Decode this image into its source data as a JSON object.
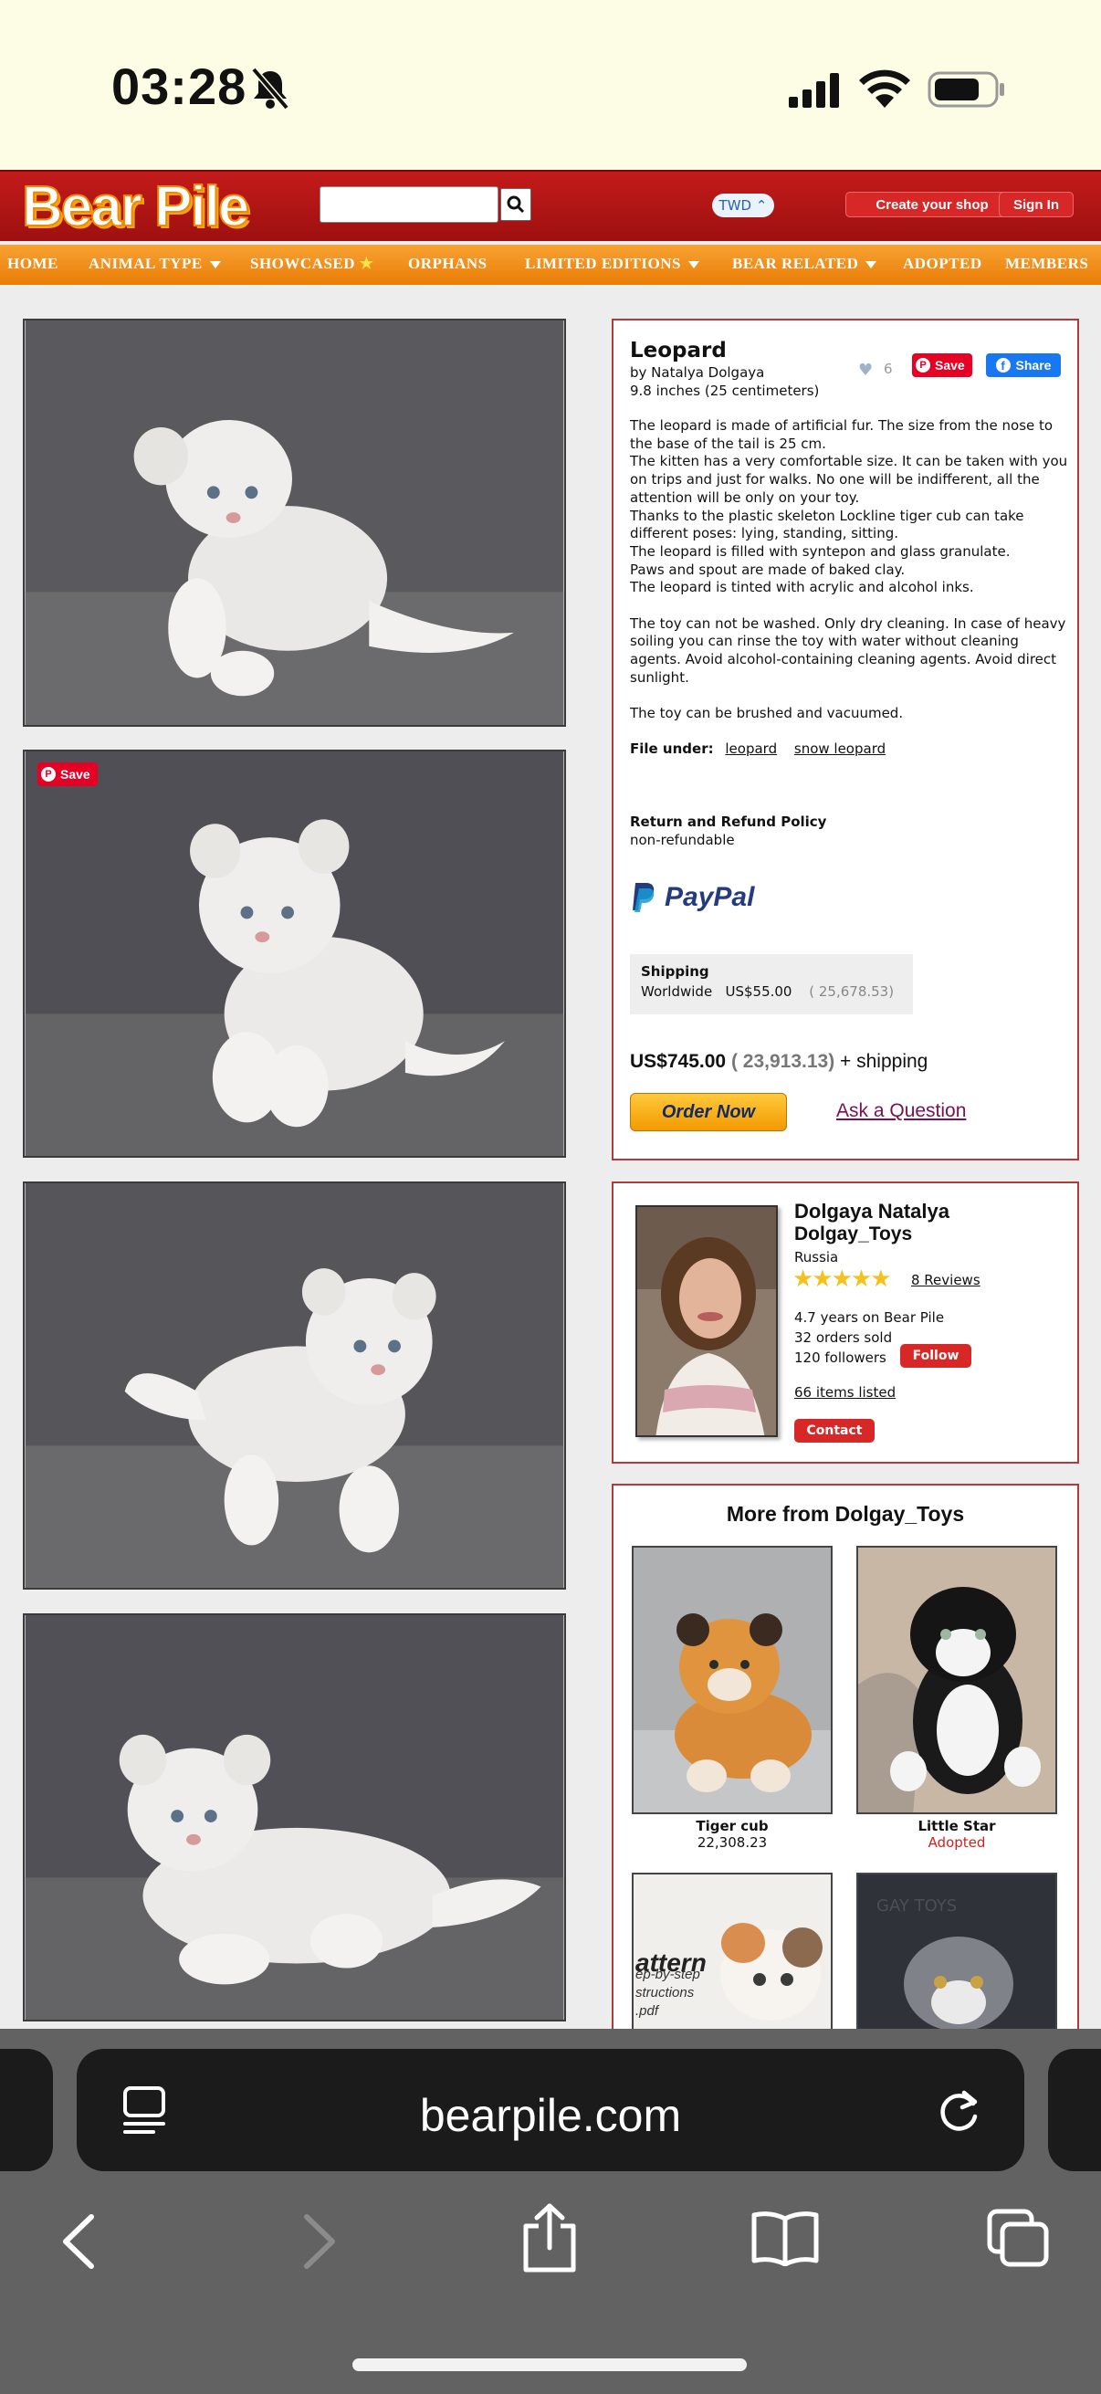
{
  "status_bar": {
    "time": "03:28"
  },
  "header": {
    "logo": "Bear Pile",
    "search_placeholder": "",
    "currency": "TWD",
    "create_shop_label": "Create your shop",
    "sign_in_label": "Sign In"
  },
  "nav": {
    "items": [
      "HOME",
      "ANIMAL TYPE",
      "SHOWCASED",
      "ORPHANS",
      "LIMITED EDITIONS",
      "BEAR RELATED",
      "ADOPTED",
      "MEMBERS"
    ]
  },
  "photos": {
    "save_label": "Save"
  },
  "product": {
    "title": "Leopard",
    "by": "by Natalya Dolgaya",
    "size": "9.8 inches (25 centimeters)",
    "likes": "6",
    "save_label": "Save",
    "share_label": "Share",
    "description": [
      "The leopard is made of artificial fur. The size from the nose to the base of the tail is 25 cm.\nThe kitten has a very comfortable size. It can be taken with you on trips and just for walks. No one will be indifferent, all the attention will be only on your toy.\nThanks to the plastic skeleton Lockline tiger cub can take different poses: lying, standing, sitting.\nThe leopard is filled with syntepon and glass granulate.\nPaws and spout are made of baked clay.\nThe leopard is tinted with acrylic and alcohol inks.",
      "The toy can not be washed. Only dry cleaning. In case of heavy soiling you can rinse the toy with water without cleaning agents. Avoid alcohol-containing cleaning agents. Avoid direct sunlight.",
      "The toy can be brushed and vacuumed."
    ],
    "file_under_label": "File under:",
    "tags": [
      "leopard",
      "snow leopard"
    ],
    "refund_heading": "Return and Refund Policy",
    "refund_value": "non-refundable",
    "paypal": "PayPal",
    "shipping_heading": "Shipping",
    "shipping_region": "Worldwide",
    "shipping_price": "US$55.00",
    "shipping_converted": "( 25,678.53)",
    "price": "US$745.00",
    "price_converted": "( 23,913.13)",
    "price_suffix": "+ shipping",
    "order_label": "Order Now",
    "ask_label": "Ask a Question"
  },
  "seller": {
    "name": "Dolgaya Natalya",
    "shop": "Dolgay_Toys",
    "country": "Russia",
    "rating": 5,
    "reviews": "8 Reviews",
    "years": "4.7 years on Bear Pile",
    "orders": "32 orders sold",
    "followers": "120 followers",
    "follow_label": "Follow",
    "items_listed": "66 items listed",
    "contact_label": "Contact"
  },
  "more": {
    "title": "More from Dolgay_Toys",
    "items": [
      {
        "name": "Tiger cub",
        "price": "22,308.23"
      },
      {
        "name": "Little Star",
        "status": "Adopted"
      }
    ],
    "third_thumb_text": "attern\nep-by-step\nstructions\n.pdf"
  },
  "browser": {
    "url": "bearpile.com"
  },
  "colors": {
    "brand_red": "#c41a1a",
    "nav_orange": "#f29a1f",
    "panel_border": "#b23a3a"
  }
}
